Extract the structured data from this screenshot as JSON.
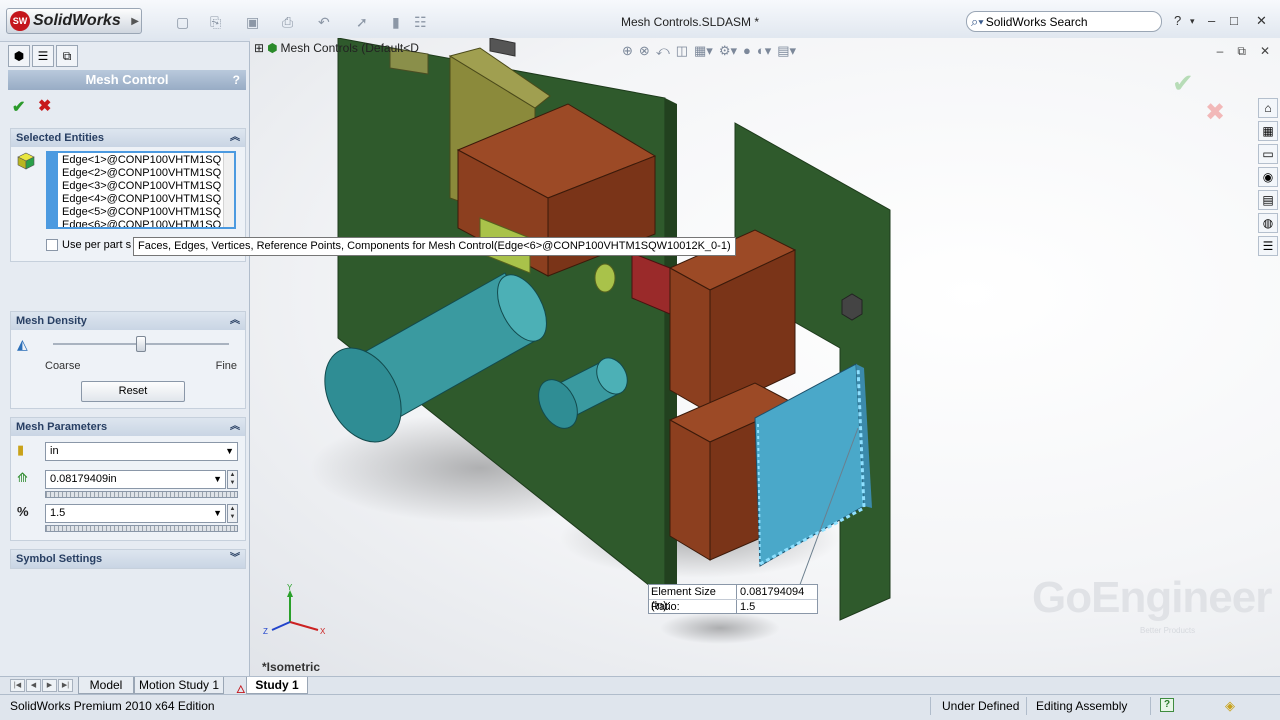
{
  "app": {
    "logo_badge": "SW",
    "logo_text": "SolidWorks",
    "document_title": "Mesh Controls.SLDASM *",
    "search_placeholder": "SolidWorks Search",
    "help_icon": "?",
    "win_min": "–",
    "win_max": "□",
    "win_close": "✕"
  },
  "panel": {
    "title": "Mesh Control",
    "help": "?",
    "selected_entities": {
      "heading": "Selected Entities",
      "items": [
        "Edge<1>@CONP100VHTM1SQ",
        "Edge<2>@CONP100VHTM1SQ",
        "Edge<3>@CONP100VHTM1SQ",
        "Edge<4>@CONP100VHTM1SQ",
        "Edge<5>@CONP100VHTM1SQ",
        "Edge<6>@CONP100VHTM1SQ"
      ],
      "use_per_part_label": "Use per part s"
    },
    "tooltip": "Faces, Edges, Vertices, Reference Points, Components for Mesh Control(Edge<6>@CONP100VHTM1SQW10012K_0-1)",
    "mesh_density": {
      "heading": "Mesh Density",
      "coarse": "Coarse",
      "fine": "Fine",
      "reset": "Reset",
      "level": 0.5
    },
    "mesh_parameters": {
      "heading": "Mesh Parameters",
      "unit": "in",
      "element_size": "0.08179409in",
      "ratio": "1.5"
    },
    "symbol_settings": {
      "heading": "Symbol Settings"
    }
  },
  "viewport": {
    "tree_root": "Mesh Controls (Default<D",
    "view_label": "*Isometric",
    "watermark": "GoEngineer",
    "watermark_sub": "Better Products",
    "readout": {
      "size_label": "Element Size (in):",
      "size_value": "0.081794094",
      "ratio_label": "Ratio:",
      "ratio_value": "1.5"
    },
    "triad": {
      "y": "Y",
      "x": "X",
      "z": "Z"
    },
    "colors": {
      "board": "#2f5a2c",
      "brown": "#8c3f1f",
      "teal": "#3a9aa0",
      "selection": "#5ab7e6"
    }
  },
  "tabs": {
    "items": [
      "Model",
      "Motion Study 1",
      "Study 1"
    ],
    "active": "Study 1"
  },
  "status": {
    "edition": "SolidWorks Premium 2010 x64 Edition",
    "state": "Under Defined",
    "mode": "Editing Assembly",
    "help": "?"
  }
}
